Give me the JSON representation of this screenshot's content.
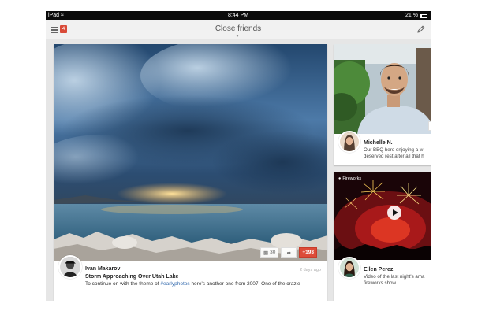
{
  "status_bar": {
    "carrier": "iPad",
    "time": "8:44 PM",
    "battery": "21 %"
  },
  "app_bar": {
    "title": "Close friends",
    "notification_count": "4"
  },
  "icons": [
    "menu-icon",
    "notification-badge",
    "compose-icon",
    "comment-icon",
    "share-icon",
    "play-icon",
    "wifi-icon",
    "battery-icon"
  ],
  "colors": {
    "accent_red": "#dd4b39",
    "hashtag_blue": "#3a6fb0"
  },
  "main_post": {
    "author": "Ivan Makarov",
    "title": "Storm Approaching Over Utah Lake",
    "text_before": "To continue on with the theme of ",
    "hashtag": "#earlyphotos",
    "text_after": " here's another one from 2007. One of the crazie",
    "timestamp": "2 days ago",
    "comments": "30",
    "plus_count": "+193"
  },
  "side_post_1": {
    "author": "Michelle N.",
    "line1": "Our BBQ hero enjoying a w",
    "line2": "deserved rest after all that h"
  },
  "side_post_2": {
    "label": "Fireworks",
    "author": "Ellen Perez",
    "line1": "Video of the last night's ama",
    "line2": "fireworks show."
  }
}
